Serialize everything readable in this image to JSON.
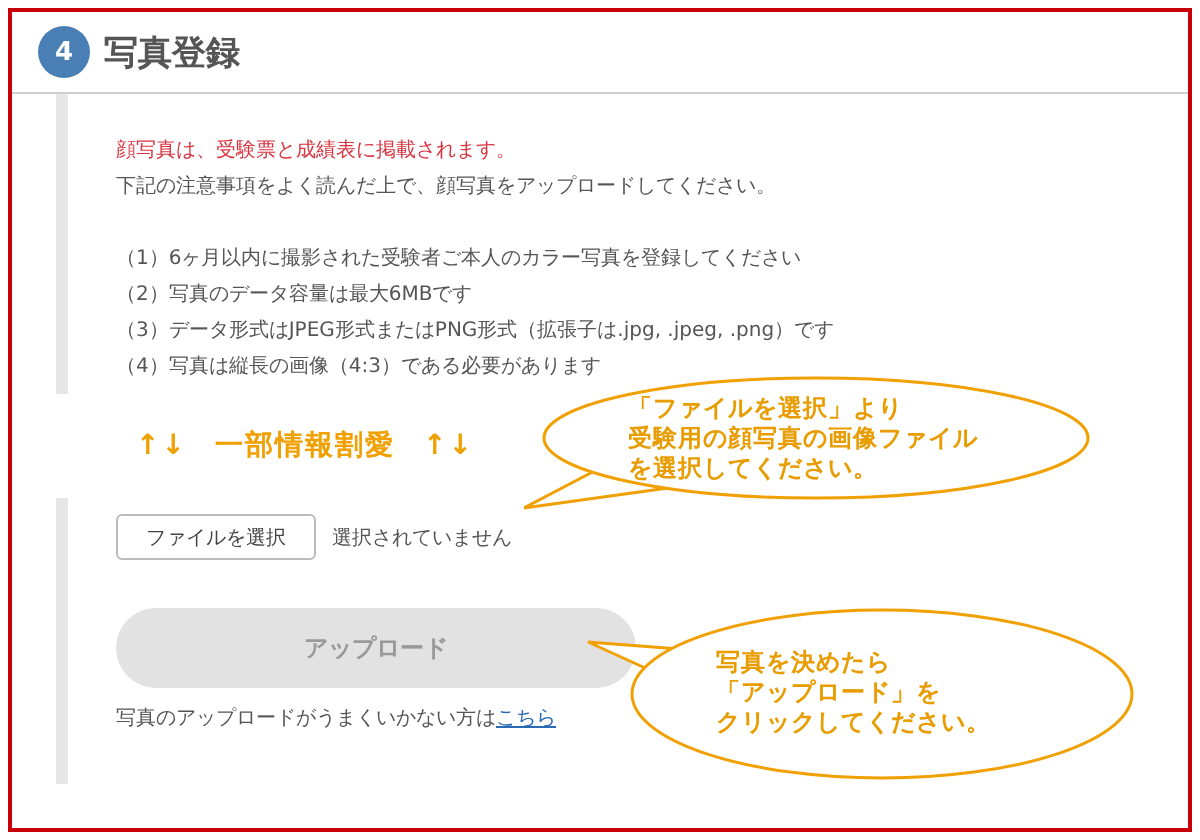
{
  "section": {
    "number": "4",
    "title": "写真登録"
  },
  "notice": {
    "warning": "顔写真は、受験票と成績表に掲載されます。",
    "instruction": "下記の注意事項をよく読んだ上で、顔写真をアップロードしてください。"
  },
  "requirements": [
    "（1）6ヶ月以内に撮影された受験者ご本人のカラー写真を登録してください",
    "（2）写真のデータ容量は最大6MBです",
    "（3）データ形式はJPEG形式またはPNG形式（拡張子は.jpg, .jpeg, .png）です",
    "（4）写真は縦長の画像（4:3）である必要があります"
  ],
  "omission": {
    "left": "↑↓",
    "label": "一部情報割愛",
    "right": "↑↓"
  },
  "file_input": {
    "button": "ファイルを選択",
    "status": "選択されていません"
  },
  "upload_button": {
    "label": "アップロード",
    "disabled": true
  },
  "help": {
    "text": "写真のアップロードがうまくいかない方は",
    "link": "こちら"
  },
  "callouts": [
    {
      "lines": [
        "「ファイルを選択」より",
        "受験用の顔写真の画像ファイル",
        "を選択してください。"
      ]
    },
    {
      "lines": [
        "写真を決めたら",
        "「アップロード」を",
        "クリックしてください。"
      ]
    }
  ]
}
